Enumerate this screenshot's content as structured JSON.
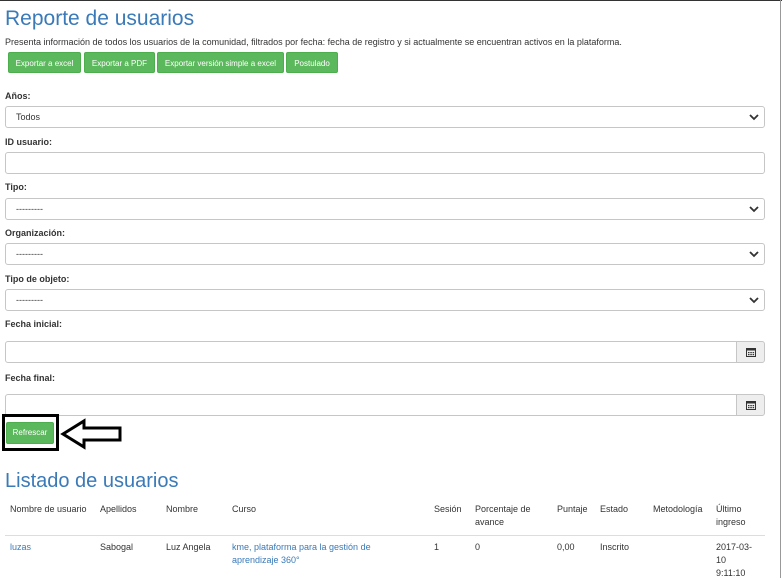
{
  "report": {
    "title": "Reporte de usuarios",
    "description": "Presenta información de todos los usuarios de la comunidad, filtrados por fecha: fecha de registro y si actualmente se encuentran activos en la plataforma.",
    "buttons": {
      "export_excel": "Exportar a excel",
      "export_pdf": "Exportar a PDF",
      "export_simple_excel": "Exportar versión simple a excel",
      "postulado": "Postulado"
    }
  },
  "filters": {
    "years": {
      "label": "Años:",
      "value": "Todos"
    },
    "user_id": {
      "label": "ID usuario:",
      "value": ""
    },
    "type": {
      "label": "Tipo:",
      "value": "---------"
    },
    "organization": {
      "label": "Organización:",
      "value": "---------"
    },
    "object_type": {
      "label": "Tipo de objeto:",
      "value": "---------"
    },
    "start_date": {
      "label": "Fecha inicial:",
      "value": ""
    },
    "end_date": {
      "label": "Fecha final:",
      "value": ""
    },
    "refresh_label": "Refrescar"
  },
  "listing": {
    "title": "Listado de usuarios",
    "headers": {
      "username": "Nombre de usuario",
      "last_name": "Apellidos",
      "first_name": "Nombre",
      "course": "Curso",
      "session": "Sesión",
      "progress_1": "Porcentaje de",
      "progress_2": "avance",
      "score": "Puntaje",
      "status": "Estado",
      "methodology": "Metodología",
      "last_login_1": "Último",
      "last_login_2": "ingreso"
    },
    "rows": [
      {
        "username": "luzas",
        "last_name": "Sabogal",
        "first_name": "Luz Angela",
        "course_1": "kme, plataforma para la gestión de",
        "course_2": "aprendizaje 360°",
        "session": "1",
        "progress": "0",
        "score": "0,00",
        "status": "Inscrito",
        "methodology": "",
        "last_login_1": "2017-03-",
        "last_login_2": "10",
        "last_login_3": "9:11:10"
      }
    ]
  },
  "colors": {
    "accent_blue": "#3a7ab8",
    "button_green": "#5cb85c"
  }
}
